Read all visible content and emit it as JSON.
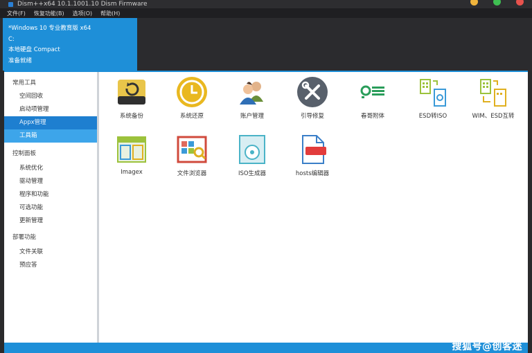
{
  "window": {
    "title": "Dism++x64 10.1.1001.10 Dism Firmware"
  },
  "menu": [
    "文件(F)",
    "恢复功能(B)",
    "选项(O)",
    "帮助(H)"
  ],
  "header": {
    "os_name": "*Windows 10 专业教育版 x64",
    "drive": "C:",
    "disk": "本地硬盘 Compact",
    "status": "准备就绪"
  },
  "sidebar": {
    "sections": [
      {
        "title": "常用工具",
        "items": [
          {
            "label": "空间回收"
          },
          {
            "label": "启动项管理"
          },
          {
            "label": "Appx管理"
          },
          {
            "label": "工具箱"
          }
        ]
      },
      {
        "title": "控制面板",
        "items": [
          {
            "label": "系统优化"
          },
          {
            "label": "驱动管理"
          },
          {
            "label": "程序和功能"
          },
          {
            "label": "可选功能"
          },
          {
            "label": "更新管理"
          }
        ]
      },
      {
        "title": "部署功能",
        "items": [
          {
            "label": "文件关联"
          },
          {
            "label": "预应答"
          }
        ]
      }
    ]
  },
  "tools": [
    {
      "label": "系统备份",
      "icon": "drive-backup-icon"
    },
    {
      "label": "系统还原",
      "icon": "clock-restore-icon"
    },
    {
      "label": "账户管理",
      "icon": "users-icon"
    },
    {
      "label": "引导修复",
      "icon": "wrench-screwdriver-icon"
    },
    {
      "label": "春哥附体",
      "icon": "toggle-list-icon"
    },
    {
      "label": "ESD转ISO",
      "icon": "esd-iso-convert-icon"
    },
    {
      "label": "WIM、ESD互转",
      "icon": "wim-esd-convert-icon"
    },
    {
      "label": "Imagex",
      "icon": "imagex-icon"
    },
    {
      "label": "文件浏览器",
      "icon": "file-browser-icon"
    },
    {
      "label": "ISO生成器",
      "icon": "iso-disc-icon"
    },
    {
      "label": "hosts编辑器",
      "icon": "hosts-file-icon"
    }
  ],
  "watermark": "搜狐号@创客迷",
  "colors": {
    "accent": "#1e8fd8",
    "selected_dark": "#1e7fd0",
    "selected_light": "#3da5ea"
  }
}
